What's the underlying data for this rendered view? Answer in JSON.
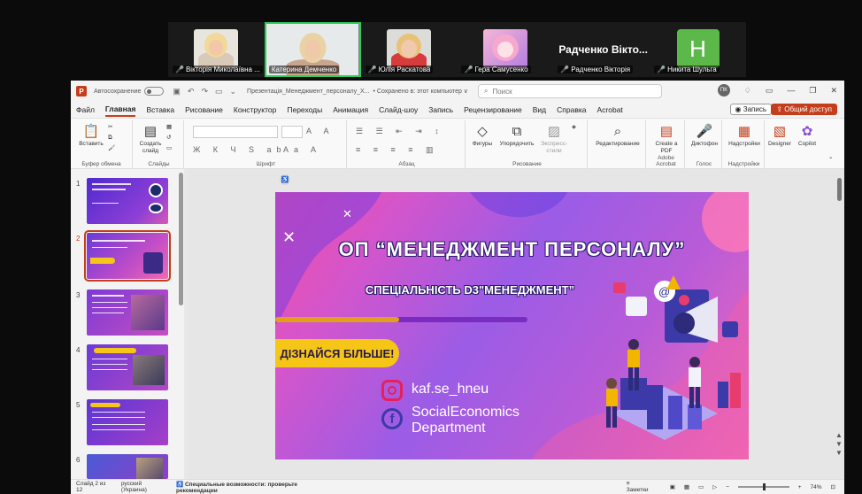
{
  "participants": [
    {
      "name": "Вікторія Миколаївна ...",
      "kind": "photo",
      "muted": true
    },
    {
      "name": "Катерина Демченко",
      "kind": "video",
      "muted": false,
      "active": true
    },
    {
      "name": "Юлія Раскатова",
      "kind": "photo",
      "muted": true
    },
    {
      "name": "Гера Самусенко",
      "kind": "photo",
      "muted": true
    },
    {
      "name": "Радченко Вікторія",
      "display": "Радченко Вікто...",
      "kind": "text",
      "muted": true
    },
    {
      "name": "Никита Шульга",
      "initial": "Н",
      "kind": "initial",
      "muted": true
    }
  ],
  "ppt": {
    "autosave_label": "Автосохранение",
    "doc_title": "Презентація_Менеджмент_персоналу_Х...",
    "saved_status": "• Сохранено в: этот компьютер ∨",
    "search_placeholder": "Поиск",
    "user_initials": "ПК",
    "tabs": [
      "Файл",
      "Главная",
      "Вставка",
      "Рисование",
      "Конструктор",
      "Переходы",
      "Анимация",
      "Слайд-шоу",
      "Запись",
      "Рецензирование",
      "Вид",
      "Справка",
      "Acrobat"
    ],
    "selected_tab": "Главная",
    "record_button": "Запись",
    "share_button": "Общий доступ",
    "ribbon": {
      "paste": "Вставить",
      "new_slide": "Создать слайд",
      "shapes": "Фигуры",
      "arrange": "Упорядочить",
      "quick_styles": "Экспресс-стили",
      "editing": "Редактирование",
      "create_pdf": "Create a PDF",
      "dictate": "Диктофон",
      "addins": "Надстройки",
      "designer": "Designer",
      "copilot": "Copilot",
      "group_labels": {
        "clipboard": "Буфер обмена",
        "slides": "Слайды",
        "font": "Шрифт",
        "paragraph": "Абзац",
        "drawing": "Рисование",
        "acrobat": "Adobe Acrobat",
        "voice": "Голос",
        "addins": "Надстройки"
      }
    },
    "thumb_numbers": [
      "1",
      "2",
      "3",
      "4",
      "5",
      "6"
    ],
    "slide": {
      "title": "ОП “МЕНЕДЖМЕНТ ПЕРСОНАЛУ”",
      "subtitle": "СПЕЦІАЛЬНІСТЬ D3\"МЕНЕДЖМЕНТ”",
      "cta": "ДІЗНАЙСЯ БІЛЬШЕ!",
      "instagram": "kaf.se_hneu",
      "facebook_line1": "SocialEconomics",
      "facebook_line2": "Department"
    },
    "status": {
      "slide_counter": "Слайд 2 из 12",
      "language": "русский (Украина)",
      "accessibility": "Специальные возможности: проверьте рекомендации",
      "notes": "Заметки",
      "zoom": "74%"
    }
  }
}
